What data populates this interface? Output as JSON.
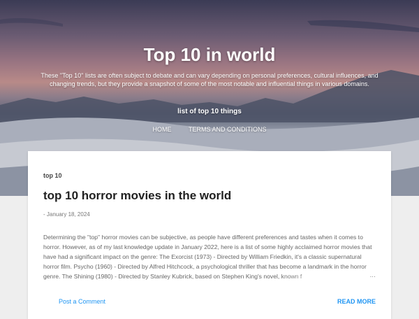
{
  "header": {
    "site_title": "Top 10 in world",
    "description": "These \"Top 10\" lists are often subject to debate and can vary depending on personal preferences, cultural influences, and changing trends, but they provide a snapshot of some of the most notable and influential things in various domains.",
    "tagline": "list of top 10 things"
  },
  "nav": {
    "items": [
      {
        "label": "HOME"
      },
      {
        "label": "TERMS AND CONDITIONS"
      }
    ]
  },
  "post": {
    "label": "top 10",
    "title": "top 10 horror movies in the world",
    "date": "- January 18, 2024",
    "snippet": "Determining the \"top\" horror movies can be subjective, as people have different preferences and tastes when it comes to horror. However, as of my last knowledge update in January 2022, here is a list of some highly acclaimed horror movies that have had a significant impact on the genre: The Exorcist (1973) - Directed by William Friedkin, it's a classic supernatural horror film. Psycho (1960) - Directed by Alfred Hitchcock, a psychological thriller that has become a landmark in the horror genre. The Shining (1980) - Directed by Stanley Kubrick, based on Stephen King's novel, known f",
    "ellipsis": "…",
    "comment_label": "Post a Comment",
    "read_more_label": "READ MORE"
  },
  "colors": {
    "link": "#2196f3",
    "page_bg": "#eeeeee",
    "card_bg": "#ffffff"
  }
}
